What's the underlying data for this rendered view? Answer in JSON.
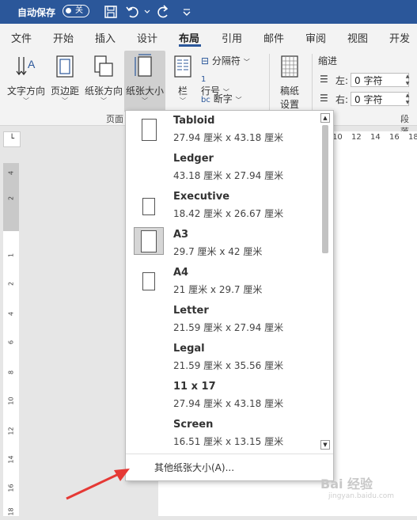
{
  "titlebar": {
    "autosave_label": "自动保存",
    "toggle_state": "关",
    "bg_color": "#2b579a"
  },
  "tabs": [
    {
      "label": "文件",
      "active": false
    },
    {
      "label": "开始",
      "active": false
    },
    {
      "label": "插入",
      "active": false
    },
    {
      "label": "设计",
      "active": false
    },
    {
      "label": "布局",
      "active": true
    },
    {
      "label": "引用",
      "active": false
    },
    {
      "label": "邮件",
      "active": false
    },
    {
      "label": "审阅",
      "active": false
    },
    {
      "label": "视图",
      "active": false
    },
    {
      "label": "开发工",
      "active": false
    }
  ],
  "ribbon": {
    "text_direction": "文字方向",
    "margins": "页边距",
    "orientation": "纸张方向",
    "size": "纸张大小",
    "columns": "栏",
    "breaks": "分隔符",
    "line_numbers": "行号",
    "hyphenation": "断字",
    "manuscript_1": "稿纸",
    "manuscript_2": "设置",
    "indent_title": "缩进",
    "indent_left_label": "左:",
    "indent_left_value": "0 字符",
    "indent_right_label": "右:",
    "indent_right_value": "0 字符",
    "group_page": "页面",
    "group_paragraph": "段落"
  },
  "hruler": [
    "10",
    "12",
    "14",
    "16",
    "18"
  ],
  "vruler": [
    "4",
    "2",
    "1",
    "2",
    "4",
    "6",
    "8",
    "10",
    "12",
    "14",
    "16",
    "18"
  ],
  "dropdown": {
    "items": [
      {
        "name": "Tabloid",
        "dims": "27.94 厘米 x 43.18 厘米",
        "selected": false
      },
      {
        "name": "Ledger",
        "dims": "43.18 厘米 x 27.94 厘米",
        "selected": false
      },
      {
        "name": "Executive",
        "dims": "18.42 厘米 x 26.67 厘米",
        "selected": false
      },
      {
        "name": "A3",
        "dims": "29.7 厘米 x 42 厘米",
        "selected": true
      },
      {
        "name": "A4",
        "dims": "21 厘米 x 29.7 厘米",
        "selected": false
      },
      {
        "name": "Letter",
        "dims": "21.59 厘米 x 27.94 厘米",
        "selected": false
      },
      {
        "name": "Legal",
        "dims": "21.59 厘米 x 35.56 厘米",
        "selected": false
      },
      {
        "name": "11 x 17",
        "dims": "27.94 厘米 x 43.18 厘米",
        "selected": false
      },
      {
        "name": "Screen",
        "dims": "16.51 厘米 x 13.15 厘米",
        "selected": false
      }
    ],
    "more_label": "其他纸张大小(A)..."
  },
  "watermark": {
    "text": "Bai 经验",
    "url": "jingyan.baidu.com"
  },
  "colors": {
    "accent": "#2b579a",
    "arrow": "#e53935"
  }
}
